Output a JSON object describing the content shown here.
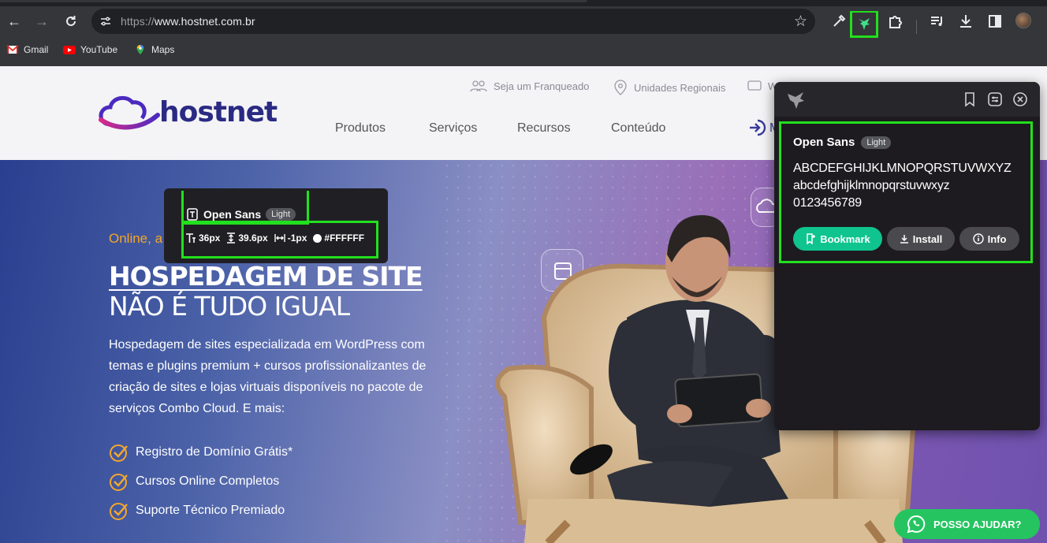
{
  "browser": {
    "url_proto": "https://",
    "url_host": "www.hostnet.com.br",
    "bookmarks": [
      {
        "label": "Gmail",
        "icon": "gmail-icon"
      },
      {
        "label": "YouTube",
        "icon": "youtube-icon"
      },
      {
        "label": "Maps",
        "icon": "maps-icon"
      }
    ],
    "active_extension_color": "#22e01d"
  },
  "site": {
    "logo_text": "hostnet",
    "top_links": [
      "Seja um Franqueado",
      "Unidades Regionais",
      "W"
    ],
    "nav": [
      "Produtos",
      "Serviços",
      "Recursos",
      "Conteúdo"
    ],
    "nav_partial": "M",
    "hero": {
      "eyebrow": "Online, a",
      "headline_1": "HOSPEDAGEM DE SITE",
      "headline_2": "NÃO É TUDO IGUAL",
      "description": "Hospedagem de sites especializada em WordPress com temas e plugins premium + cursos profissionalizantes de criação de sites e lojas virtuais disponíveis no pacote de serviços Combo Cloud. E mais:",
      "features": [
        "Registro de Domínio Grátis*",
        "Cursos Online Completos",
        "Suporte Técnico Premiado"
      ]
    },
    "whatsapp_label": "POSSO AJUDAR?"
  },
  "tooltip": {
    "font_name": "Open Sans",
    "weight": "Light",
    "size": "36px",
    "line_height": "39.6px",
    "letter_spacing": "-1px",
    "color": "#FFFFFF"
  },
  "panel": {
    "font_name": "Open Sans",
    "weight": "Light",
    "sample_upper": "ABCDEFGHIJKLMNOPQRSTUVWXYZ",
    "sample_lower": "abcdefghijklmnopqrstuvwxyz",
    "sample_digits": "0123456789",
    "bookmark_label": "Bookmark",
    "install_label": "Install",
    "info_label": "Info"
  },
  "colors": {
    "accent_green": "#0fc48e",
    "highlight": "#22e01d",
    "brand_blue": "#2a2a84",
    "eyebrow_orange": "#f4a72a",
    "whatsapp": "#25c461"
  }
}
